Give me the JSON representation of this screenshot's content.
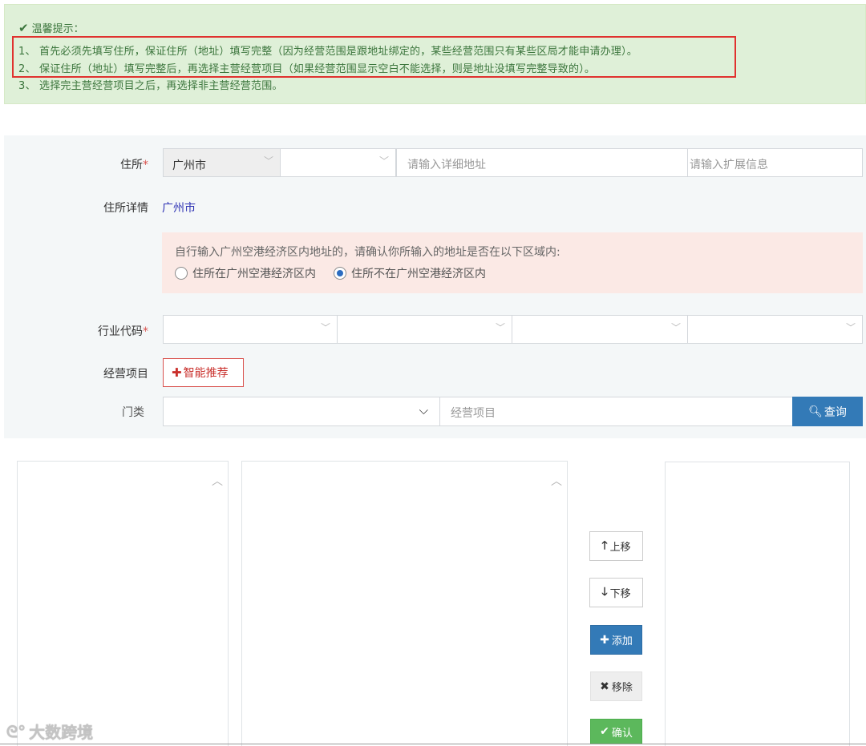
{
  "tip": {
    "title": "温馨提示：",
    "line1": "1、 首先必须先填写住所，保证住所（地址）填写完整（因为经营范围是跟地址绑定的，某些经营范围只有某些区局才能申请办理）。",
    "line2": "2、 保证住所（地址）填写完整后，再选择主营经营项目（如果经营范围显示空白不能选择，则是地址没填写完整导致的）。",
    "line3": "3、 选择完主营经营项目之后，再选择非主营经营范围。"
  },
  "address": {
    "label": "住所",
    "required_mark": "*",
    "city_value": "广州市",
    "district_value": "",
    "detail_placeholder": "请输入详细地址",
    "ext_placeholder": "请输入扩展信息"
  },
  "address_detail": {
    "label": "住所详情",
    "value": "广州市"
  },
  "notice": {
    "text": "自行输入广州空港经济区内地址的，请确认你所输入的地址是否在以下区域内:",
    "option_in": "住所在广州空港经济区内",
    "option_out": "住所不在广州空港经济区内",
    "selected": "option_out"
  },
  "industry": {
    "label": "行业代码",
    "required_mark": "*"
  },
  "business": {
    "label": "经营项目",
    "recommend_button": "智能推荐"
  },
  "category": {
    "label": "门类",
    "select_value": "",
    "search_placeholder": "经营项目",
    "query_button": "查询"
  },
  "actions": {
    "move_up": "上移",
    "move_down": "下移",
    "add": "添加",
    "remove": "移除",
    "confirm": "确认"
  },
  "watermark": "大数跨境",
  "colors": {
    "tip_bg": "#dff0d8",
    "tip_text": "#3c763d",
    "highlight_border": "#e0322f",
    "primary": "#337ab7",
    "danger": "#d9534f",
    "success": "#5cb85c"
  }
}
